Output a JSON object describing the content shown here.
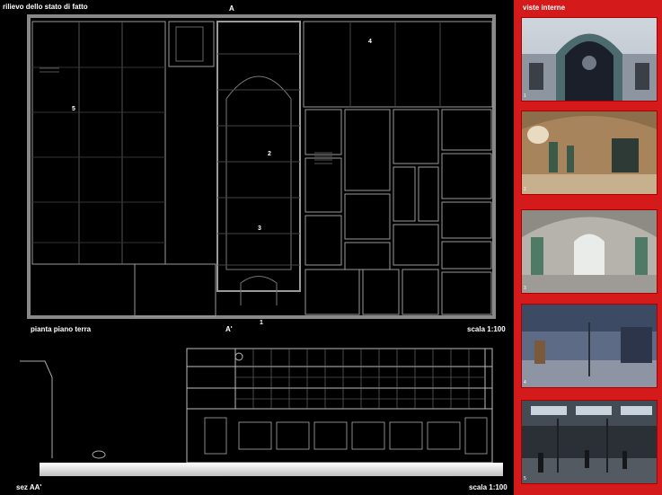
{
  "plan": {
    "title": "rilievo dello stato di fatto",
    "caption": "pianta piano terra",
    "scale": "scala 1:100",
    "cut_top": "A",
    "cut_bottom": "A'",
    "rooms": [
      "1",
      "2",
      "3",
      "4",
      "5"
    ]
  },
  "section": {
    "caption": "sez AA'",
    "scale": "scala 1:100"
  },
  "sidebar": {
    "title": "viste interne",
    "photos": [
      {
        "num": "1",
        "desc": "facade-arch"
      },
      {
        "num": "2",
        "desc": "vaulted-hall-warm"
      },
      {
        "num": "3",
        "desc": "vaulted-hall-window"
      },
      {
        "num": "4",
        "desc": "empty-shed-blue"
      },
      {
        "num": "5",
        "desc": "industrial-shed-people"
      }
    ]
  },
  "colors": {
    "accent": "#d41a1a",
    "background": "#000000",
    "linework": "#9a9a9a"
  }
}
